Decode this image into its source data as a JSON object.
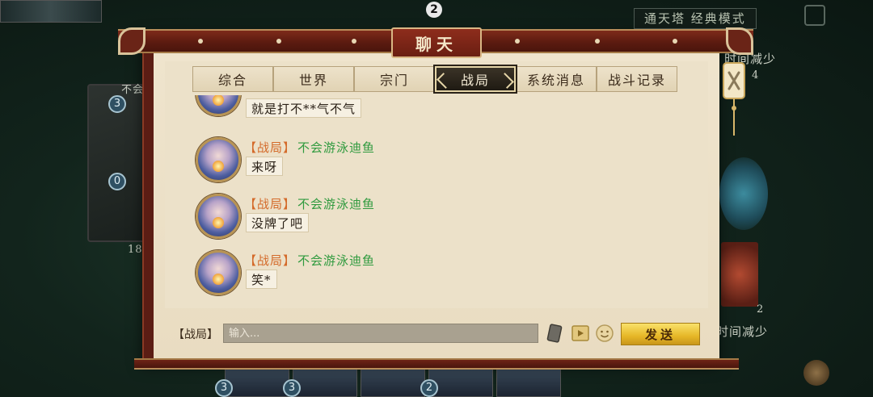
{
  "background": {
    "top_card_count": "2",
    "mode_label": "通天塔 经典模式",
    "right_text_top": "时间减少",
    "right_num_top": "4",
    "right_text_bottom": "时间减少",
    "right_num_bottom": "2",
    "left_label": "不会",
    "left_coin_top": "3",
    "left_coin_mid": "0",
    "left_num_bottom": "18",
    "bottom_coins": [
      "3",
      "3",
      "2"
    ]
  },
  "dialog": {
    "title": "聊天",
    "tabs": [
      {
        "label": "综合",
        "active": false
      },
      {
        "label": "世界",
        "active": false
      },
      {
        "label": "宗门",
        "active": false
      },
      {
        "label": "战局",
        "active": true
      },
      {
        "label": "系统消息",
        "active": false
      },
      {
        "label": "战斗记录",
        "active": false
      }
    ],
    "messages": [
      {
        "channel": "",
        "user": "",
        "text": "就是打不**气不气"
      },
      {
        "channel": "【战局】",
        "user": "不会游泳迪鱼",
        "text": "来呀"
      },
      {
        "channel": "【战局】",
        "user": "不会游泳迪鱼",
        "text": "没牌了吧"
      },
      {
        "channel": "【战局】",
        "user": "不会游泳迪鱼",
        "text": "笑*"
      }
    ],
    "input": {
      "channel_label": "【战局】",
      "placeholder": "输入..."
    },
    "send_label": "发送"
  },
  "icons": {
    "close": "close-icon",
    "card": "card-icon",
    "video": "video-icon",
    "emoji": "emoji-icon"
  },
  "colors": {
    "channel": "#d46a2a",
    "username": "#2f9a3e",
    "send_button": "#f0c73a",
    "dialog_frame": "#5b1d14",
    "paper": "#ece1c9"
  }
}
